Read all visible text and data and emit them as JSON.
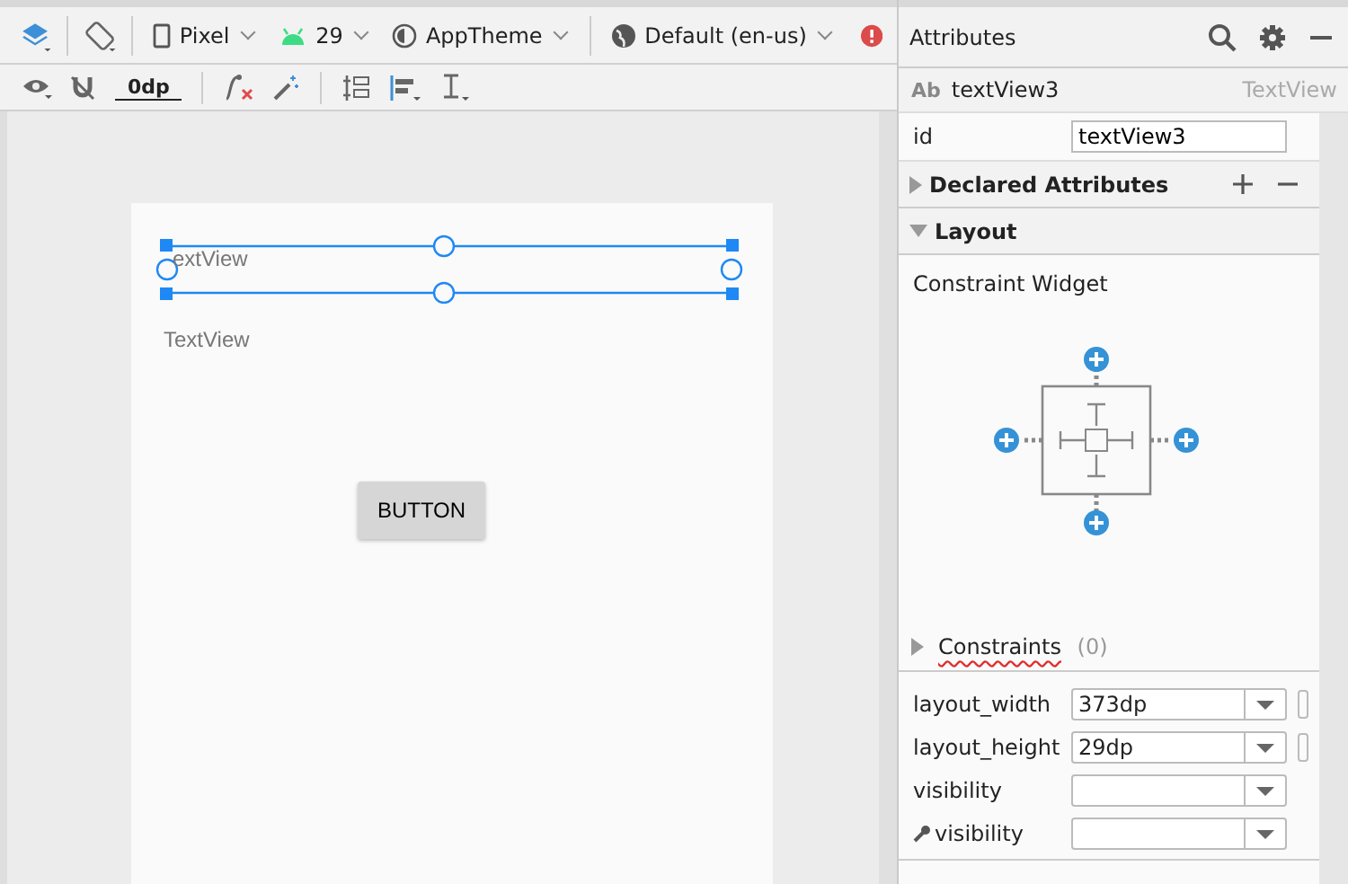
{
  "toolbar": {
    "device": "Pixel",
    "api": "29",
    "theme": "AppTheme",
    "locale": "Default (en-us)",
    "margin": "0dp"
  },
  "canvas": {
    "selected_text": "extView",
    "text": "TextView",
    "button": "BUTTON"
  },
  "attributes": {
    "title": "Attributes",
    "component": {
      "icon_text": "Ab",
      "name": "textView3",
      "class": "TextView"
    },
    "id": {
      "label": "id",
      "value": "textView3"
    },
    "sections": [
      {
        "title": "Declared Attributes",
        "expanded": false
      },
      {
        "title": "Layout",
        "expanded": true
      }
    ],
    "widget_label": "Constraint Widget",
    "constraints": {
      "label": "Constraints",
      "count": "(0)",
      "expanded": false
    },
    "fields": [
      {
        "kind": "plain",
        "label": "layout_width",
        "value": "373dp",
        "handle": true
      },
      {
        "kind": "plain",
        "label": "layout_height",
        "value": "29dp",
        "handle": true
      },
      {
        "kind": "plain",
        "label": "visibility",
        "handle": false
      },
      {
        "kind": "tools",
        "label": "visibility",
        "handle": false
      }
    ]
  }
}
